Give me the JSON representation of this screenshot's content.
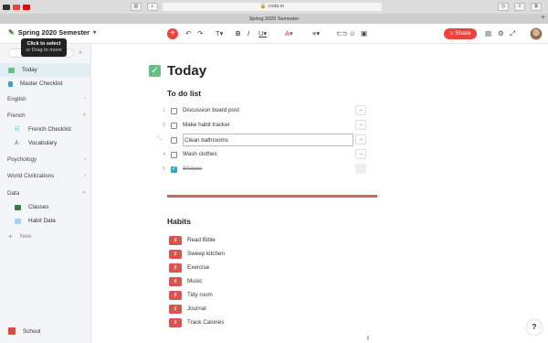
{
  "browser": {
    "url": "coda.io",
    "tab_title": "Spring 2020 Semester"
  },
  "toolbar": {
    "doc_title": "Spring 2020 Semester",
    "share_label": "Share"
  },
  "tooltip": {
    "title": "Click to select",
    "subtitle": "or Drag to move"
  },
  "sidebar": {
    "items": [
      {
        "label": "Today",
        "icon": "check-page-icon",
        "color": "#65c08a"
      },
      {
        "label": "Master Checklist",
        "icon": "list-page-icon",
        "color": "#36a8c7"
      }
    ],
    "sections": [
      {
        "label": "English"
      },
      {
        "label": "French"
      },
      {
        "label": "Psychology"
      },
      {
        "label": "World Civilizations"
      },
      {
        "label": "Data"
      }
    ],
    "french_items": [
      {
        "label": "French Checklist",
        "icon": "checklist-icon"
      },
      {
        "label": "Vocabulary",
        "icon": "person-icon"
      }
    ],
    "data_items": [
      {
        "label": "Classes",
        "icon": "table-icon"
      },
      {
        "label": "Habit Data",
        "icon": "table-icon"
      }
    ],
    "new_label": "New",
    "workspace": "School"
  },
  "page": {
    "title": "Today",
    "todo_heading": "To do list",
    "todos": [
      {
        "num": "1",
        "text": "Discussion board post",
        "done": false
      },
      {
        "num": "2",
        "text": "Make habit tracker",
        "done": false
      },
      {
        "num": "3",
        "text": "Clean bathrooms",
        "done": false
      },
      {
        "num": "4",
        "text": "Wash clothes",
        "done": false
      },
      {
        "num": "5",
        "text": "Shower",
        "done": true
      }
    ],
    "habits_heading": "Habits",
    "habits": [
      "Read Bible",
      "Sweep kitchen",
      "Exercise",
      "Music",
      "Tidy room",
      "Journal",
      "Track Calories"
    ]
  },
  "help_label": "?",
  "colors": {
    "accent": "#e8453c",
    "habit": "#d9534f",
    "divider": "#d06560",
    "check": "#36a8c7"
  }
}
